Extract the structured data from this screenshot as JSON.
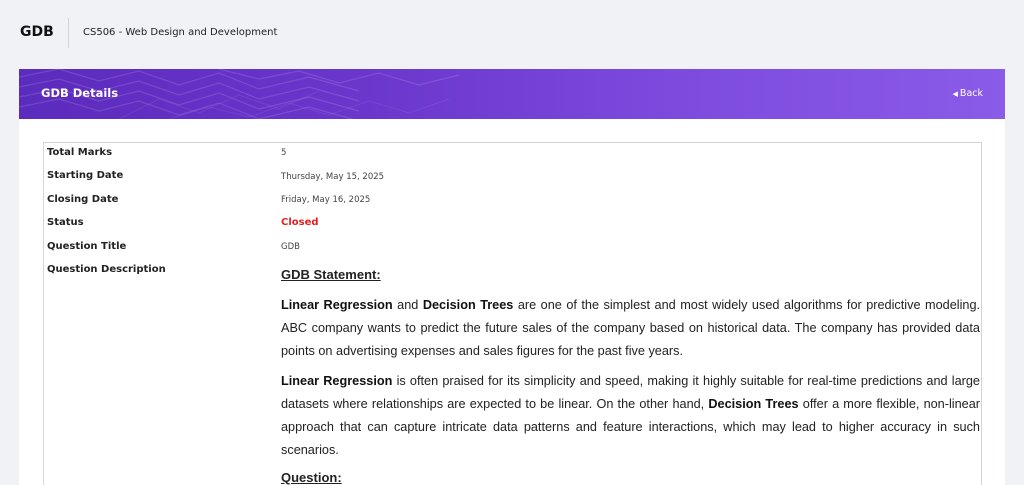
{
  "topbar": {
    "title": "GDB",
    "course": "CS506 - Web Design and Development"
  },
  "card": {
    "title": "GDB Details",
    "back_label": "Back",
    "back_icon": "caret-left-icon"
  },
  "details": {
    "total_marks_label": "Total Marks",
    "total_marks": "5",
    "starting_date_label": "Starting Date",
    "starting_date": "Thursday, May 15, 2025",
    "closing_date_label": "Closing Date",
    "closing_date": "Friday, May 16, 2025",
    "status_label": "Status",
    "status": "Closed",
    "question_title_label": "Question Title",
    "question_title": "GDB",
    "question_description_label": "Question Description"
  },
  "description": {
    "heading": "GDB Statement:",
    "p1": {
      "term1": "Linear Regression",
      "t1": " and ",
      "term2": "Decision Trees",
      "t2": " are one of the simplest and most widely used algorithms for predictive modeling. ABC company wants to predict the future sales of the company based on historical data. The company has provided data points on advertising expenses and sales figures for the past five years."
    },
    "p2": {
      "term1": "Linear Regression",
      "t1": " is often praised for its simplicity and speed, making it highly suitable for real-time predictions and large datasets where relationships are expected to be linear. On the other hand, ",
      "term2": "Decision Trees",
      "t2": " offer a more flexible, non-linear approach that can capture intricate data patterns and feature interactions, which may lead to higher accuracy in such scenarios."
    },
    "question_heading": "Question:"
  },
  "colors": {
    "header_gradient_start": "#5b2bbd",
    "header_gradient_end": "#8a5ae8",
    "status_closed": "#e41f1f",
    "page_background": "#f1f2f6"
  }
}
